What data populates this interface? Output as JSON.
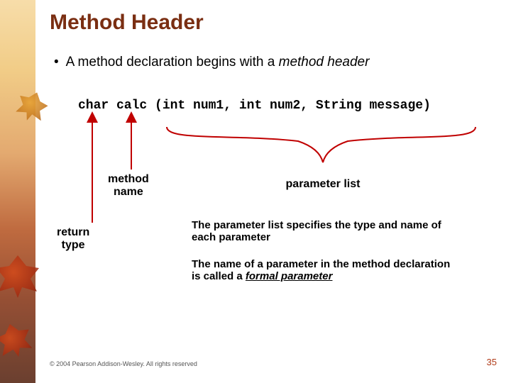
{
  "title": "Method Header",
  "bullet_prefix": "A method declaration begins with a ",
  "bullet_emph": "method header",
  "code": "char calc (int num1, int num2, String message)",
  "labels": {
    "method_name_l1": "method",
    "method_name_l2": "name",
    "parameter_list": "parameter list",
    "return_type_l1": "return",
    "return_type_l2": "type"
  },
  "explain1": "The parameter list specifies the type and name of each parameter",
  "explain2_prefix": "The name of a parameter in the method declaration is called a ",
  "explain2_emph": "formal parameter",
  "footer": "© 2004 Pearson Addison-Wesley. All rights reserved",
  "page": "35"
}
